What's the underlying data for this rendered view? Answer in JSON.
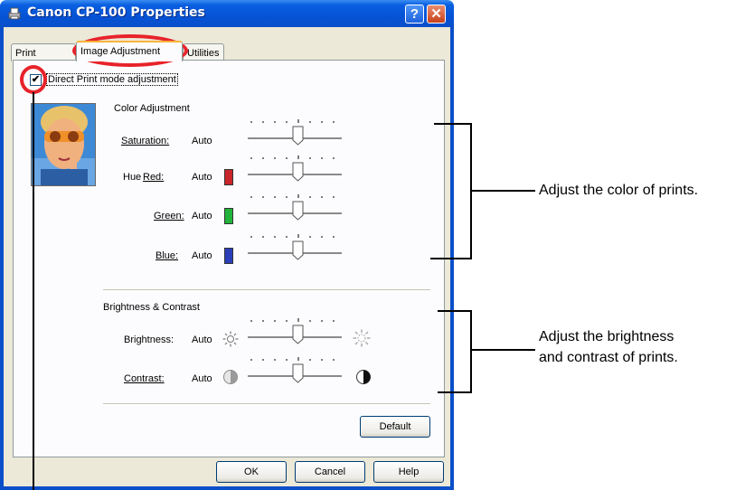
{
  "window": {
    "title": "Canon CP-100 Properties",
    "help_symbol": "?",
    "close_symbol": "✕"
  },
  "tabs": [
    {
      "label": "Print Settings"
    },
    {
      "label": "Image Adjustment"
    },
    {
      "label": "Utilities"
    }
  ],
  "direct_print": {
    "label": "Direct Print mode adjustment",
    "checked": true
  },
  "color_adjustment": {
    "heading": "Color Adjustment",
    "saturation": {
      "label": "Saturation:",
      "value": "Auto"
    },
    "hue_label": "Hue",
    "red": {
      "label": "Red:",
      "value": "Auto",
      "color": "#c8262b"
    },
    "green": {
      "label": "Green:",
      "value": "Auto",
      "color": "#22b43a"
    },
    "blue": {
      "label": "Blue:",
      "value": "Auto",
      "color": "#2b3fb8"
    }
  },
  "brightness_contrast": {
    "heading": "Brightness & Contrast",
    "brightness": {
      "label": "Brightness:",
      "value": "Auto"
    },
    "contrast": {
      "label": "Contrast:",
      "value": "Auto"
    }
  },
  "buttons": {
    "default": "Default",
    "ok": "OK",
    "cancel": "Cancel",
    "help": "Help"
  },
  "callouts": {
    "color": "Adjust the color of prints.",
    "brightness_line1": "Adjust the brightness",
    "brightness_line2": "and contrast of prints."
  },
  "colors": {
    "highlight_ring": "#e8232a",
    "titlebar": "#0553d6"
  }
}
